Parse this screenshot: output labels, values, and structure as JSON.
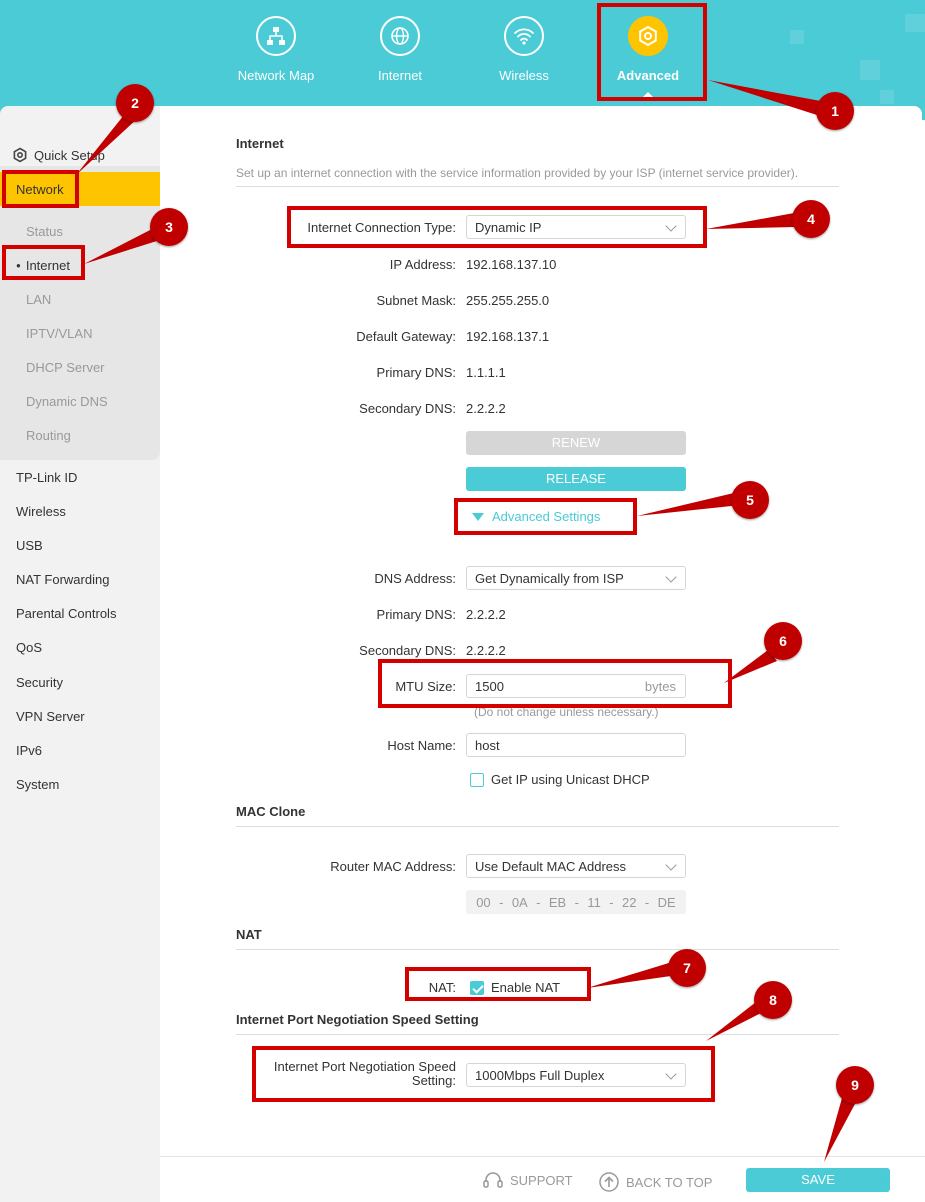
{
  "top_nav": [
    {
      "label": "Network Map",
      "icon": "network-map-icon"
    },
    {
      "label": "Internet",
      "icon": "globe-icon"
    },
    {
      "label": "Wireless",
      "icon": "wifi-icon"
    },
    {
      "label": "Advanced",
      "icon": "gear-icon",
      "active": true
    }
  ],
  "sidebar": {
    "quick_setup": "Quick Setup",
    "network": "Network",
    "sub": [
      "Status",
      "Internet",
      "LAN",
      "IPTV/VLAN",
      "DHCP Server",
      "Dynamic DNS",
      "Routing"
    ],
    "items": [
      "TP-Link ID",
      "Wireless",
      "USB",
      "NAT Forwarding",
      "Parental Controls",
      "QoS",
      "Security",
      "VPN Server",
      "IPv6",
      "System"
    ]
  },
  "internet": {
    "title": "Internet",
    "desc": "Set up an internet connection with the service information provided by your ISP (internet service provider).",
    "conn_type_label": "Internet Connection Type:",
    "conn_type_value": "Dynamic IP",
    "ip_label": "IP Address:",
    "ip_value": "192.168.137.10",
    "mask_label": "Subnet Mask:",
    "mask_value": "255.255.255.0",
    "gw_label": "Default Gateway:",
    "gw_value": "192.168.137.1",
    "pdns_label": "Primary DNS:",
    "pdns_value": "1.1.1.1",
    "sdns_label": "Secondary DNS:",
    "sdns_value": "2.2.2.2",
    "renew": "RENEW",
    "release": "RELEASE",
    "advanced": "Advanced Settings",
    "dns_addr_label": "DNS Address:",
    "dns_addr_value": "Get Dynamically from ISP",
    "pdns2_label": "Primary DNS:",
    "pdns2_value": "2.2.2.2",
    "sdns2_label": "Secondary DNS:",
    "sdns2_value": "2.2.2.2",
    "mtu_label": "MTU Size:",
    "mtu_value": "1500",
    "mtu_unit": "bytes",
    "mtu_hint": "(Do not change unless necessary.)",
    "host_label": "Host Name:",
    "host_value": "host",
    "unicast_label": "Get IP using Unicast DHCP"
  },
  "mac_clone": {
    "title": "MAC Clone",
    "router_mac_label": "Router MAC Address:",
    "router_mac_value": "Use Default MAC Address",
    "mac_octets": [
      "00",
      "0A",
      "EB",
      "11",
      "22",
      "DE"
    ]
  },
  "nat": {
    "title": "NAT",
    "label": "NAT:",
    "enable": "Enable NAT"
  },
  "port_speed": {
    "title": "Internet Port Negotiation Speed Setting",
    "label_line1": "Internet Port Negotiation Speed",
    "label_line2": "Setting:",
    "value": "1000Mbps Full Duplex"
  },
  "footer": {
    "support": "SUPPORT",
    "back_to_top": "BACK TO TOP",
    "save": "SAVE"
  },
  "annotations": [
    "1",
    "2",
    "3",
    "4",
    "5",
    "6",
    "7",
    "8",
    "9"
  ],
  "colors": {
    "accent": "#4acbd6",
    "active": "#ffc400",
    "annotation": "#d40000"
  }
}
